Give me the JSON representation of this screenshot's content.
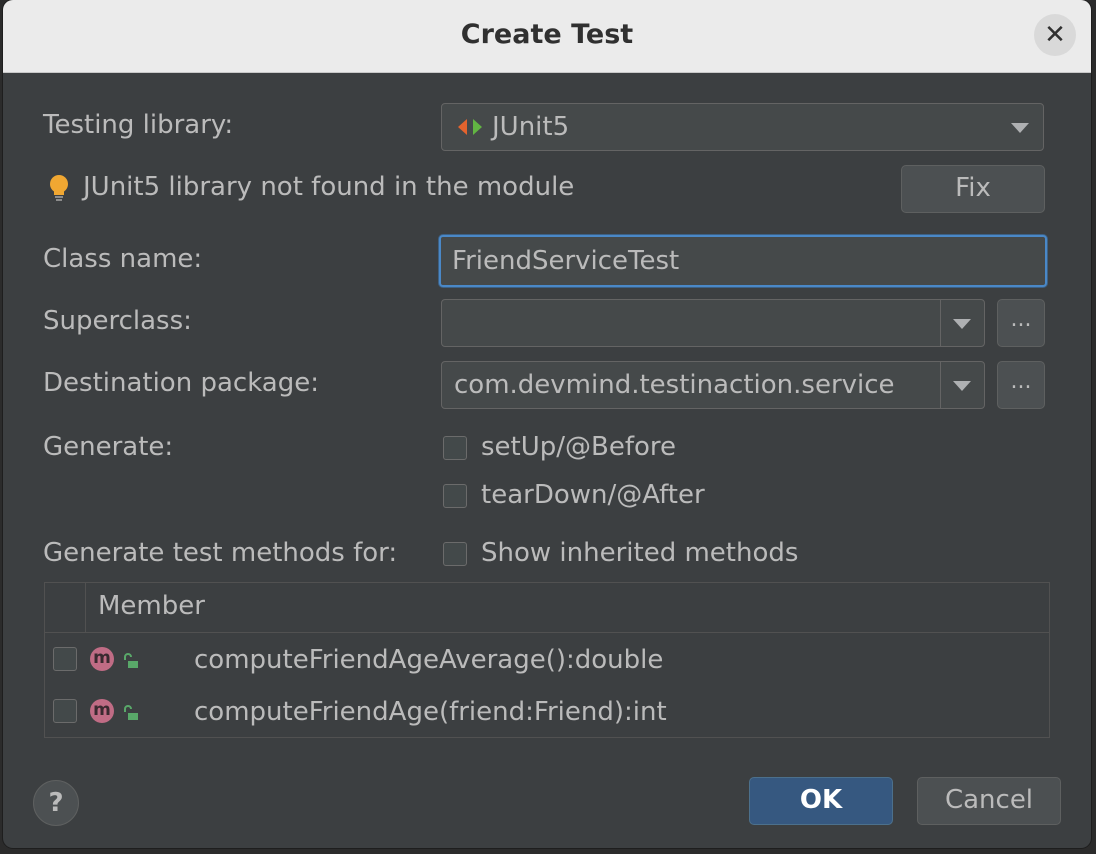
{
  "dialog": {
    "title": "Create Test"
  },
  "testing_library": {
    "label": "Testing library:",
    "value": "JUnit5"
  },
  "warning": {
    "text": "JUnit5 library not found in the module",
    "fix_label": "Fix"
  },
  "class_name": {
    "label": "Class name:",
    "value": "FriendServiceTest"
  },
  "superclass": {
    "label": "Superclass:",
    "value": "",
    "browse_label": "..."
  },
  "destination": {
    "label": "Destination package:",
    "value": "com.devmind.testinaction.service",
    "browse_label": "..."
  },
  "generate": {
    "label": "Generate:",
    "options": [
      "setUp/@Before",
      "tearDown/@After"
    ]
  },
  "methods": {
    "label": "Generate test methods for:",
    "show_inherited": "Show inherited methods",
    "column_header": "Member",
    "rows": [
      "computeFriendAgeAverage():double",
      "computeFriendAge(friend:Friend):int"
    ]
  },
  "footer": {
    "help": "?",
    "ok": "OK",
    "cancel": "Cancel"
  },
  "colors": {
    "focus": "#4a88c7",
    "ok_button": "#365880",
    "bulb": "#f0a732",
    "method_badge": "#c06c85",
    "lock": "#59a869"
  }
}
